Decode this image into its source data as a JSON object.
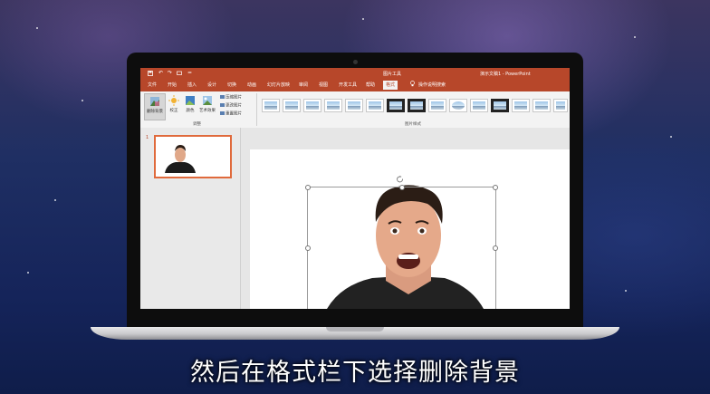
{
  "window": {
    "context_tab_group": "图片工具",
    "title": "演示文稿1 - PowerPoint"
  },
  "qat": {
    "save_icon": "save-icon",
    "undo_icon": "undo-icon",
    "redo_icon": "redo-icon",
    "present_icon": "present-icon",
    "more": "="
  },
  "tabs": [
    {
      "label": "文件"
    },
    {
      "label": "开始"
    },
    {
      "label": "插入"
    },
    {
      "label": "设计"
    },
    {
      "label": "切换"
    },
    {
      "label": "动画"
    },
    {
      "label": "幻灯片放映"
    },
    {
      "label": "审阅"
    },
    {
      "label": "视图"
    },
    {
      "label": "开发工具"
    },
    {
      "label": "帮助"
    },
    {
      "label": "格式"
    }
  ],
  "tell_me": "操作说明搜索",
  "ribbon": {
    "remove_background": "删除背景",
    "corrections": "校正",
    "color": "颜色",
    "artistic_effects": "艺术效果",
    "compress": "压缩图片",
    "change_picture": "更改图片",
    "reset_picture": "重置图片",
    "group_adjust": "调整",
    "group_picture_styles": "图片样式"
  },
  "slides": {
    "current_number": "1"
  },
  "subtitle": "然后在格式栏下选择删除背景",
  "colors": {
    "accent": "#b7472a",
    "selected_thumb_border": "#e06a3c"
  }
}
